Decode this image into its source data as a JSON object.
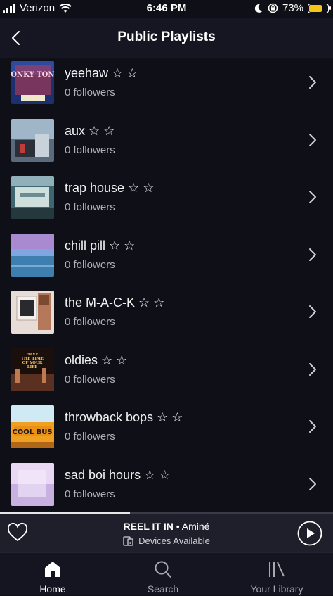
{
  "status_bar": {
    "carrier": "Verizon",
    "time": "6:46 PM",
    "battery": "73%",
    "battery_level": 0.73,
    "battery_color": "#f5c518"
  },
  "header": {
    "title": "Public Playlists",
    "back_icon": "chevron-left-icon"
  },
  "playlists": [
    {
      "name": "yeehaw ☆ ☆",
      "followers": "0 followers",
      "art_text": "HONKY TONK"
    },
    {
      "name": "aux ☆ ☆",
      "followers": "0 followers"
    },
    {
      "name": "trap house ☆ ☆",
      "followers": "0 followers"
    },
    {
      "name": "chill pill ☆ ☆",
      "followers": "0 followers"
    },
    {
      "name": "the M-A-C-K ☆ ☆",
      "followers": "0 followers"
    },
    {
      "name": "oldies ☆ ☆",
      "followers": "0 followers",
      "art_text": "HAVE THE TIME OF YOUR LIFE"
    },
    {
      "name": "throwback bops ☆ ☆",
      "followers": "0 followers",
      "art_text": "COOL BUS"
    },
    {
      "name": "sad boi hours ☆ ☆",
      "followers": "0 followers"
    }
  ],
  "now_playing": {
    "track": "REEL IT IN",
    "artist_line": " • Aminé",
    "devices": "Devices Available",
    "progress": 0.39
  },
  "tabs": [
    {
      "label": "Home",
      "icon": "home-icon",
      "active": true
    },
    {
      "label": "Search",
      "icon": "search-icon",
      "active": false
    },
    {
      "label": "Your Library",
      "icon": "library-icon",
      "active": false
    }
  ]
}
